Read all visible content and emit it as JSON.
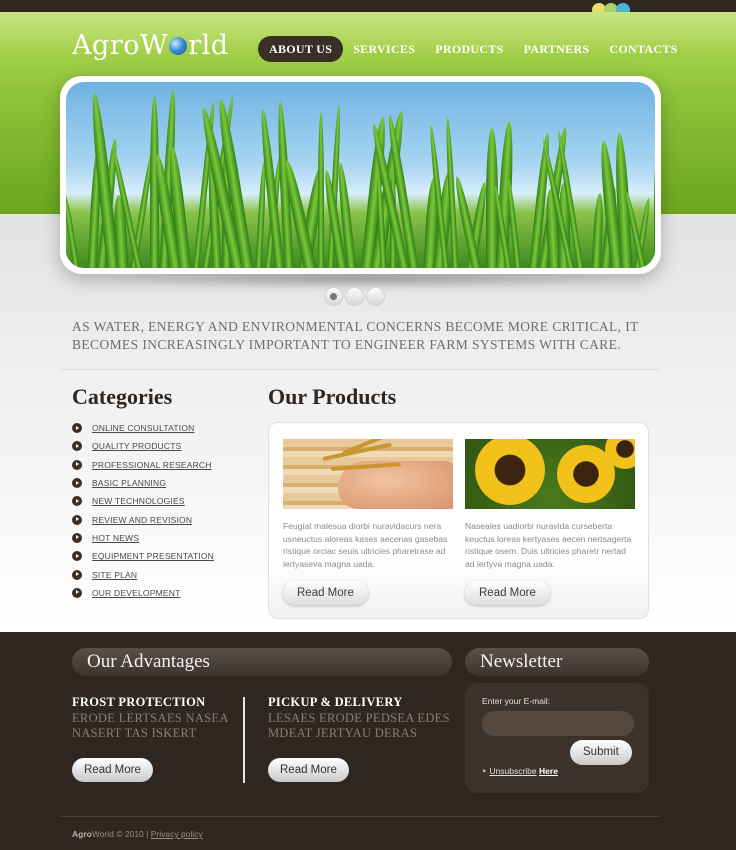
{
  "header": {
    "logo_part1": "Agro",
    "logo_part2_before": "W",
    "logo_part2_after": "rld",
    "nav": [
      {
        "label": "ABOUT US",
        "active": true
      },
      {
        "label": "SERVICES",
        "active": false
      },
      {
        "label": "PRODUCTS",
        "active": false
      },
      {
        "label": "PARTNERS",
        "active": false
      },
      {
        "label": "CONTACTS",
        "active": false
      }
    ],
    "color_swatches": [
      "#e6dd6a",
      "#a9d36a",
      "#4bb5d8"
    ]
  },
  "slider": {
    "dot_count": 3,
    "active_index": 0
  },
  "intro": {
    "text": "AS WATER, ENERGY AND ENVIRONMENTAL CONCERNS BECOME MORE CRITICAL, IT BECOMES INCREASINGLY IMPORTANT TO ENGINEER FARM SYSTEMS WITH CARE."
  },
  "categories": {
    "title": "Categories",
    "items": [
      "ONLINE CONSULTATION",
      "QUALITY PRODUCTS",
      "PROFESSIONAL RESEARCH",
      "BASIC PLANNING",
      "NEW TECHNOLOGIES",
      "REVIEW AND REVISION",
      "HOT NEWS",
      "EQUIPMENT PRESENTATION",
      "SITE PLAN",
      "OUR DEVELOPMENT"
    ]
  },
  "products": {
    "title": "Our Products",
    "items": [
      {
        "text": "Feugiat malesua diorbi nuravidacurs nera usneuctus aloreas kases aecenas gasebas ristique orciac seuis ultricies pharetrase ad lertyaseva magna uada.",
        "button": "Read More"
      },
      {
        "text": "Naseales uadiorbi nuravida curseberta keuctus loreas kertyases aecen nertsagerta ristique osem. Duis ultricies pharetr nertad ad lertyva magna uada.",
        "button": "Read More"
      }
    ]
  },
  "advantages": {
    "title": "Our Advantages",
    "items": [
      {
        "title": "FROST PROTECTION",
        "line1": "ERODE LERTSAES NASEA",
        "line2": "NASERT TAS ISKERT",
        "button": "Read More"
      },
      {
        "title": "PICKUP & DELIVERY",
        "line1": "LESAES ERODE PEDSEA EDES",
        "line2": "MDEAT JERTYAU DERAS",
        "button": "Read More"
      }
    ]
  },
  "newsletter": {
    "title": "Newsletter",
    "label": "Enter your E-mail:",
    "email_value": "",
    "submit": "Submit",
    "unsubscribe": "Unsubscribe",
    "here": "Here"
  },
  "footer": {
    "brand_bold": "Agro",
    "brand_rest": "World © 2010",
    "separator": "|",
    "privacy": "Privacy policy"
  }
}
